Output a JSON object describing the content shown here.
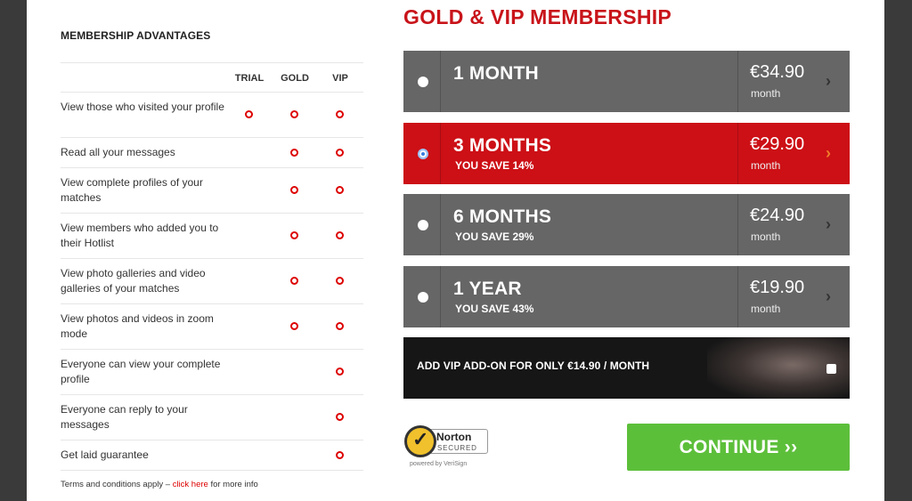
{
  "advantages": {
    "title": "MEMBERSHIP ADVANTAGES",
    "columns": [
      "TRIAL",
      "GOLD",
      "VIP"
    ],
    "rows": [
      {
        "text": "View those who visited your profile",
        "trial": true,
        "gold": true,
        "vip": true
      },
      {
        "text": "Read all your messages",
        "trial": false,
        "gold": true,
        "vip": true
      },
      {
        "text": "View complete profiles of your matches",
        "trial": false,
        "gold": true,
        "vip": true
      },
      {
        "text": "View members who added you to their Hotlist",
        "trial": false,
        "gold": true,
        "vip": true
      },
      {
        "text": "View photo galleries and video galleries of your matches",
        "trial": false,
        "gold": true,
        "vip": true
      },
      {
        "text": "View photos and videos in zoom mode",
        "trial": false,
        "gold": true,
        "vip": true
      },
      {
        "text": "Everyone can view your complete profile",
        "trial": false,
        "gold": false,
        "vip": true
      },
      {
        "text": "Everyone can reply to your messages",
        "trial": false,
        "gold": false,
        "vip": true
      },
      {
        "text": "Get laid guarantee",
        "trial": false,
        "gold": false,
        "vip": true
      }
    ],
    "terms_prefix": "Terms and conditions apply –",
    "terms_link": "click here",
    "terms_suffix": "for more info"
  },
  "membership": {
    "title": "GOLD & VIP MEMBERSHIP",
    "plans": [
      {
        "name": "1 MONTH",
        "save": "",
        "price": "€34.90",
        "per": "month",
        "selected": false
      },
      {
        "name": "3 MONTHS",
        "save": "YOU SAVE 14%",
        "price": "€29.90",
        "per": "month",
        "selected": true
      },
      {
        "name": "6 MONTHS",
        "save": "YOU SAVE 29%",
        "price": "€24.90",
        "per": "month",
        "selected": false
      },
      {
        "name": "1 YEAR",
        "save": "YOU SAVE 43%",
        "price": "€19.90",
        "per": "month",
        "selected": false
      }
    ],
    "vip_addon_label": "ADD VIP ADD-ON FOR ONLY €14.90 / MONTH",
    "chevron": "›"
  },
  "norton": {
    "name": "Norton",
    "secured": "SECURED",
    "powered": "powered by VeriSign"
  },
  "continue_label": "CONTINUE ››",
  "colors": {
    "accent_red": "#cc1016",
    "plan_gray": "#666666",
    "continue_green": "#5cbf3a"
  }
}
